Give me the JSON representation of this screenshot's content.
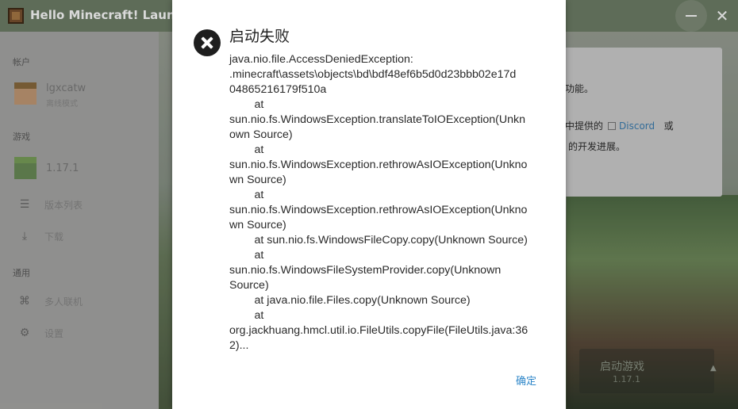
{
  "window": {
    "title": "Hello Minecraft! Launcher"
  },
  "sidebar": {
    "account_section": "帐户",
    "account": {
      "name": "lgxcatw",
      "mode": "离线模式"
    },
    "game_section": "游戏",
    "game_version": "1.17.1",
    "items": [
      {
        "label": "版本列表",
        "icon": "list-icon"
      },
      {
        "label": "下载",
        "icon": "download-icon"
      }
    ],
    "general_section": "通用",
    "general_items": [
      {
        "label": "多人联机",
        "icon": "network-icon"
      },
      {
        "label": "设置",
        "icon": "gear-icon"
      }
    ]
  },
  "main": {
    "card_lines": [
      "功能。",
      "中提供的",
      "Discord",
      "或",
      "的开发进展。"
    ],
    "launch": {
      "label": "启动游戏",
      "version": "1.17.1"
    }
  },
  "dialog": {
    "title": "启动失败",
    "icon": "error-icon",
    "lines": [
      "java.nio.file.AccessDeniedException:",
      ".minecraft\\assets\\objects\\bd\\bdf48ef6b5d0d23bbb02e17d",
      "04865216179f510a",
      "        at",
      "sun.nio.fs.WindowsException.translateToIOException(Unkn",
      "own Source)",
      "        at",
      "sun.nio.fs.WindowsException.rethrowAsIOException(Unkno",
      "wn Source)",
      "        at",
      "sun.nio.fs.WindowsException.rethrowAsIOException(Unkno",
      "wn Source)",
      "        at sun.nio.fs.WindowsFileCopy.copy(Unknown Source)",
      "        at",
      "sun.nio.fs.WindowsFileSystemProvider.copy(Unknown",
      "Source)",
      "        at java.nio.file.Files.copy(Unknown Source)",
      "        at",
      "org.jackhuang.hmcl.util.io.FileUtils.copyFile(FileUtils.java:36",
      "2)..."
    ],
    "ok_label": "确定"
  },
  "colors": {
    "accent": "#2d86c9",
    "dialog_bg": "#ffffff",
    "titlebar": "#6f7f68"
  }
}
